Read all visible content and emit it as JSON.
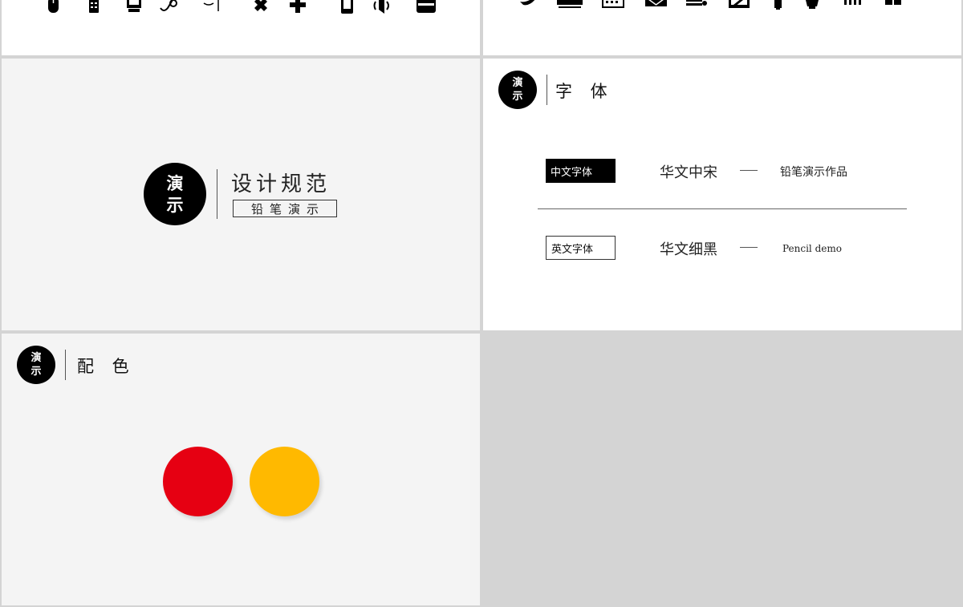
{
  "slides": {
    "cover": {
      "logo": {
        "line1": "演",
        "line2": "示"
      },
      "title": "设计规范",
      "subtitle": "铅笔演示"
    },
    "fonts": {
      "logo": {
        "line1": "演",
        "line2": "示"
      },
      "title": "字 体",
      "rows": [
        {
          "tag": "中文字体",
          "font": "华文中宋",
          "demo": "铅笔演示作品"
        },
        {
          "tag": "英文字体",
          "font": "华文细黑",
          "demo": "Pencil demo"
        }
      ]
    },
    "colors": {
      "logo": {
        "line1": "演",
        "line2": "示"
      },
      "title": "配 色",
      "swatches": [
        "#e60012",
        "#ffb900"
      ]
    }
  }
}
